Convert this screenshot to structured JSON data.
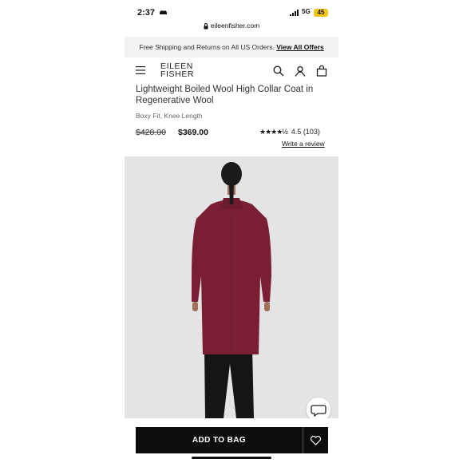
{
  "status_bar": {
    "time": "2:37",
    "network": "5G",
    "battery": "45"
  },
  "browser": {
    "url": "eileenfisher.com"
  },
  "promo": {
    "text": "Free Shipping and Returns on All US Orders.",
    "link": "View All Offers"
  },
  "header": {
    "logo_line1": "EILEEN",
    "logo_line2": "FISHER"
  },
  "product": {
    "title": "Lightweight Boiled Wool High Collar Coat in Regenerative Wool",
    "subtitle": "Boxy Fit, Knee Length",
    "price_original": "$428.00",
    "price_sale": "$369.00",
    "rating_value": "4.5",
    "rating_stars": "★★★★½",
    "review_count": "(103)",
    "review_link": "Write a review"
  },
  "actions": {
    "add_to_bag": "ADD TO BAG"
  },
  "colors": {
    "coat": "#7a1f33",
    "background": "#e4e4e4",
    "button": "#0d0d0d",
    "battery": "#f3c50c"
  },
  "icons": [
    "car-icon",
    "signal-icon",
    "lock-icon",
    "menu-icon",
    "search-icon",
    "account-icon",
    "bag-icon",
    "chat-icon",
    "heart-icon"
  ]
}
